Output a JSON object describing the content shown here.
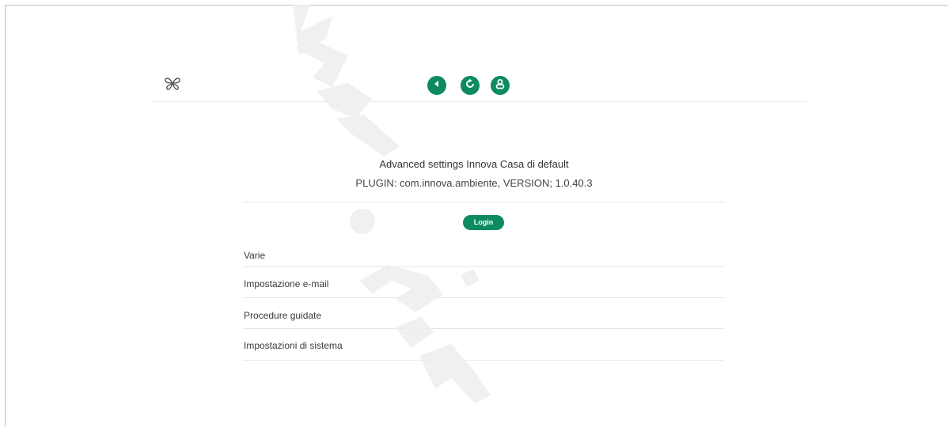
{
  "header": {
    "logo_icon": "butterfly-logo-icon",
    "buttons": [
      {
        "icon": "back-arrow-icon",
        "color": "#0d8a62"
      },
      {
        "icon": "refresh-icon",
        "color": "#0d8a62"
      },
      {
        "icon": "user-icon",
        "color": "#0d8a62"
      }
    ]
  },
  "main": {
    "title": "Advanced settings Innova Casa di default",
    "plugin_info": "PLUGIN: com.innova.ambiente, VERSION; 1.0.40.3",
    "login_label": "Login"
  },
  "menu": {
    "items": [
      {
        "label": "Varie"
      },
      {
        "label": "Impostazione e-mail"
      },
      {
        "label": "Procedure guidate"
      },
      {
        "label": "Impostazioni di sistema"
      }
    ]
  },
  "theme": {
    "accent": "#0d8a62"
  }
}
